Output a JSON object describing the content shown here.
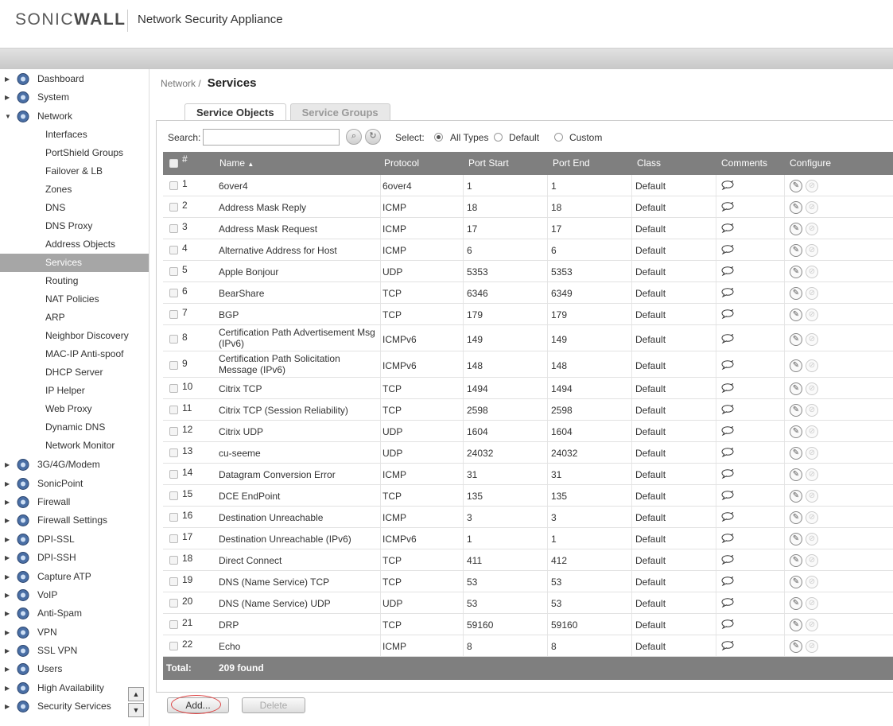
{
  "header": {
    "brand_sonic": "SONIC",
    "brand_wall": "WALL",
    "product": "Network Security Appliance"
  },
  "sidebar": {
    "top_items": [
      {
        "label": "Dashboard",
        "icon": "dashboard-icon",
        "expanded": false
      },
      {
        "label": "System",
        "icon": "monitor-icon",
        "expanded": false
      },
      {
        "label": "Network",
        "icon": "network-globe-icon",
        "expanded": true
      }
    ],
    "network_sub": [
      "Interfaces",
      "PortShield Groups",
      "Failover & LB",
      "Zones",
      "DNS",
      "DNS Proxy",
      "Address Objects",
      "Services",
      "Routing",
      "NAT Policies",
      "ARP",
      "Neighbor Discovery",
      "MAC-IP Anti-spoof",
      "DHCP Server",
      "IP Helper",
      "Web Proxy",
      "Dynamic DNS",
      "Network Monitor"
    ],
    "active_sub": "Services",
    "bottom_items": [
      {
        "label": "3G/4G/Modem",
        "icon": "modem-icon"
      },
      {
        "label": "SonicPoint",
        "icon": "access-point-icon"
      },
      {
        "label": "Firewall",
        "icon": "firewall-globe-icon"
      },
      {
        "label": "Firewall Settings",
        "icon": "firewall-settings-icon"
      },
      {
        "label": "DPI-SSL",
        "icon": "dpi-ssl-icon"
      },
      {
        "label": "DPI-SSH",
        "icon": "dpi-ssh-icon"
      },
      {
        "label": "Capture ATP",
        "icon": "capture-atp-icon"
      },
      {
        "label": "VoIP",
        "icon": "headset-icon"
      },
      {
        "label": "Anti-Spam",
        "icon": "mail-icon"
      },
      {
        "label": "VPN",
        "icon": "vpn-icon"
      },
      {
        "label": "SSL VPN",
        "icon": "ssl-vpn-icon"
      },
      {
        "label": "Users",
        "icon": "users-icon"
      },
      {
        "label": "High Availability",
        "icon": "high-availability-icon"
      },
      {
        "label": "Security Services",
        "icon": "shield-icon"
      }
    ]
  },
  "breadcrumb": {
    "parent": "Network /",
    "current": "Services"
  },
  "tabs": [
    {
      "label": "Service Objects",
      "active": true
    },
    {
      "label": "Service Groups",
      "active": false
    }
  ],
  "toolbar": {
    "search_label": "Search:",
    "search_value": "",
    "select_label": "Select:",
    "options": [
      "All Types",
      "Default",
      "Custom"
    ],
    "selected": "All Types"
  },
  "table": {
    "headers": {
      "num": "#",
      "name": "Name",
      "protocol": "Protocol",
      "port_start": "Port Start",
      "port_end": "Port End",
      "class": "Class",
      "comments": "Comments",
      "configure": "Configure"
    },
    "rows": [
      {
        "num": "1",
        "name": "6over4",
        "protocol": "6over4",
        "start": "1",
        "end": "1",
        "cls": "Default"
      },
      {
        "num": "2",
        "name": "Address Mask Reply",
        "protocol": "ICMP",
        "start": "18",
        "end": "18",
        "cls": "Default"
      },
      {
        "num": "3",
        "name": "Address Mask Request",
        "protocol": "ICMP",
        "start": "17",
        "end": "17",
        "cls": "Default"
      },
      {
        "num": "4",
        "name": "Alternative Address for Host",
        "protocol": "ICMP",
        "start": "6",
        "end": "6",
        "cls": "Default"
      },
      {
        "num": "5",
        "name": "Apple Bonjour",
        "protocol": "UDP",
        "start": "5353",
        "end": "5353",
        "cls": "Default"
      },
      {
        "num": "6",
        "name": "BearShare",
        "protocol": "TCP",
        "start": "6346",
        "end": "6349",
        "cls": "Default"
      },
      {
        "num": "7",
        "name": "BGP",
        "protocol": "TCP",
        "start": "179",
        "end": "179",
        "cls": "Default"
      },
      {
        "num": "8",
        "name": "Certification Path Advertisement Msg",
        "name2": "(IPv6)",
        "protocol": "ICMPv6",
        "start": "149",
        "end": "149",
        "cls": "Default"
      },
      {
        "num": "9",
        "name": "Certification Path Solicitation",
        "name2": "Message (IPv6)",
        "protocol": "ICMPv6",
        "start": "148",
        "end": "148",
        "cls": "Default"
      },
      {
        "num": "10",
        "name": "Citrix TCP",
        "protocol": "TCP",
        "start": "1494",
        "end": "1494",
        "cls": "Default"
      },
      {
        "num": "11",
        "name": "Citrix TCP (Session Reliability)",
        "protocol": "TCP",
        "start": "2598",
        "end": "2598",
        "cls": "Default"
      },
      {
        "num": "12",
        "name": "Citrix UDP",
        "protocol": "UDP",
        "start": "1604",
        "end": "1604",
        "cls": "Default"
      },
      {
        "num": "13",
        "name": "cu-seeme",
        "protocol": "UDP",
        "start": "24032",
        "end": "24032",
        "cls": "Default"
      },
      {
        "num": "14",
        "name": "Datagram Conversion Error",
        "protocol": "ICMP",
        "start": "31",
        "end": "31",
        "cls": "Default"
      },
      {
        "num": "15",
        "name": "DCE EndPoint",
        "protocol": "TCP",
        "start": "135",
        "end": "135",
        "cls": "Default"
      },
      {
        "num": "16",
        "name": "Destination Unreachable",
        "protocol": "ICMP",
        "start": "3",
        "end": "3",
        "cls": "Default"
      },
      {
        "num": "17",
        "name": "Destination Unreachable (IPv6)",
        "protocol": "ICMPv6",
        "start": "1",
        "end": "1",
        "cls": "Default"
      },
      {
        "num": "18",
        "name": "Direct Connect",
        "protocol": "TCP",
        "start": "411",
        "end": "412",
        "cls": "Default"
      },
      {
        "num": "19",
        "name": "DNS (Name Service) TCP",
        "protocol": "TCP",
        "start": "53",
        "end": "53",
        "cls": "Default"
      },
      {
        "num": "20",
        "name": "DNS (Name Service) UDP",
        "protocol": "UDP",
        "start": "53",
        "end": "53",
        "cls": "Default"
      },
      {
        "num": "21",
        "name": "DRP",
        "protocol": "TCP",
        "start": "59160",
        "end": "59160",
        "cls": "Default"
      },
      {
        "num": "22",
        "name": "Echo",
        "protocol": "ICMP",
        "start": "8",
        "end": "8",
        "cls": "Default"
      }
    ],
    "footer": {
      "label": "Total:",
      "count": "209 found"
    }
  },
  "buttons": {
    "add": "Add...",
    "delete": "Delete"
  },
  "colors": {
    "brand_orange": "#f39c12",
    "header_grey": "#7f7f7f",
    "active_nav": "#a6a6a6"
  }
}
